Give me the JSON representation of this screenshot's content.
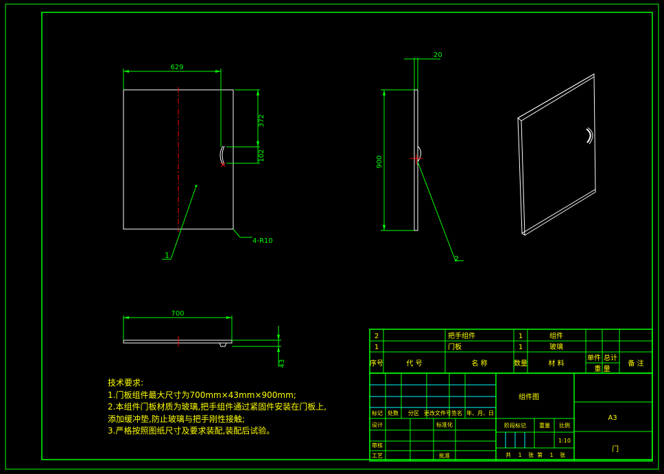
{
  "colors": {
    "frame": "#00ff00",
    "outline": "#ffffff",
    "dimension": "#00ff00",
    "centerline": "#ff0000",
    "notes_text": "#ffff00",
    "table_text": "#ffff00",
    "table_line": "#00ff00",
    "table_line_cyan": "#00ffff",
    "background": "#000000"
  },
  "front_view": {
    "dim_width": "629",
    "dim_top_to_handle": "372",
    "dim_handle": "102",
    "corner_note": "4-R10",
    "balloon": "1"
  },
  "side_view": {
    "dim_thickness": "20",
    "dim_height": "900",
    "balloon": "2"
  },
  "bottom_view": {
    "dim_width": "700",
    "dim_depth": "43"
  },
  "notes": {
    "title": "技术要求:",
    "lines": [
      "1.门板组件最大尺寸为700mm×43mm×900mm;",
      "2.本组件门板材质为玻璃,把手组件通过紧固件安装在门板上,",
      "添加缓冲垫,防止玻璃与把手刚性接触;",
      "3.严格按照图纸尺寸及要求装配,装配后试验。"
    ]
  },
  "bom": {
    "rows": [
      {
        "no": "2",
        "name": "把手组件",
        "qty": "1",
        "material": "组件"
      },
      {
        "no": "1",
        "name": "门板",
        "qty": "1",
        "material": "玻璃"
      }
    ],
    "headers": {
      "no": "序号",
      "code": "代 号",
      "name": "名 称",
      "qty": "数量",
      "material": "材 料",
      "unit": "单件",
      "total": "总计",
      "weight": "重 量",
      "remark": "备 注"
    }
  },
  "title_block": {
    "drawing_name": "组件图",
    "sheet_size": "A3",
    "part_name": "门",
    "scale": "1:10",
    "labels": {
      "mark": "标记",
      "count": "处数",
      "zone": "分区",
      "change_doc": "更改文件号",
      "sign": "签名",
      "date": "年、月、日",
      "design": "设计",
      "standardize": "标准化",
      "review": "审核",
      "process": "工艺",
      "approve": "批准",
      "stage_mark": "阶段标记",
      "weight": "重量",
      "ratio": "比例",
      "total_sheets": "共",
      "sheets_unit": "张",
      "sheet_no": "第",
      "sheet_unit": "张",
      "total_value": "1",
      "sheet_value": "1"
    }
  }
}
